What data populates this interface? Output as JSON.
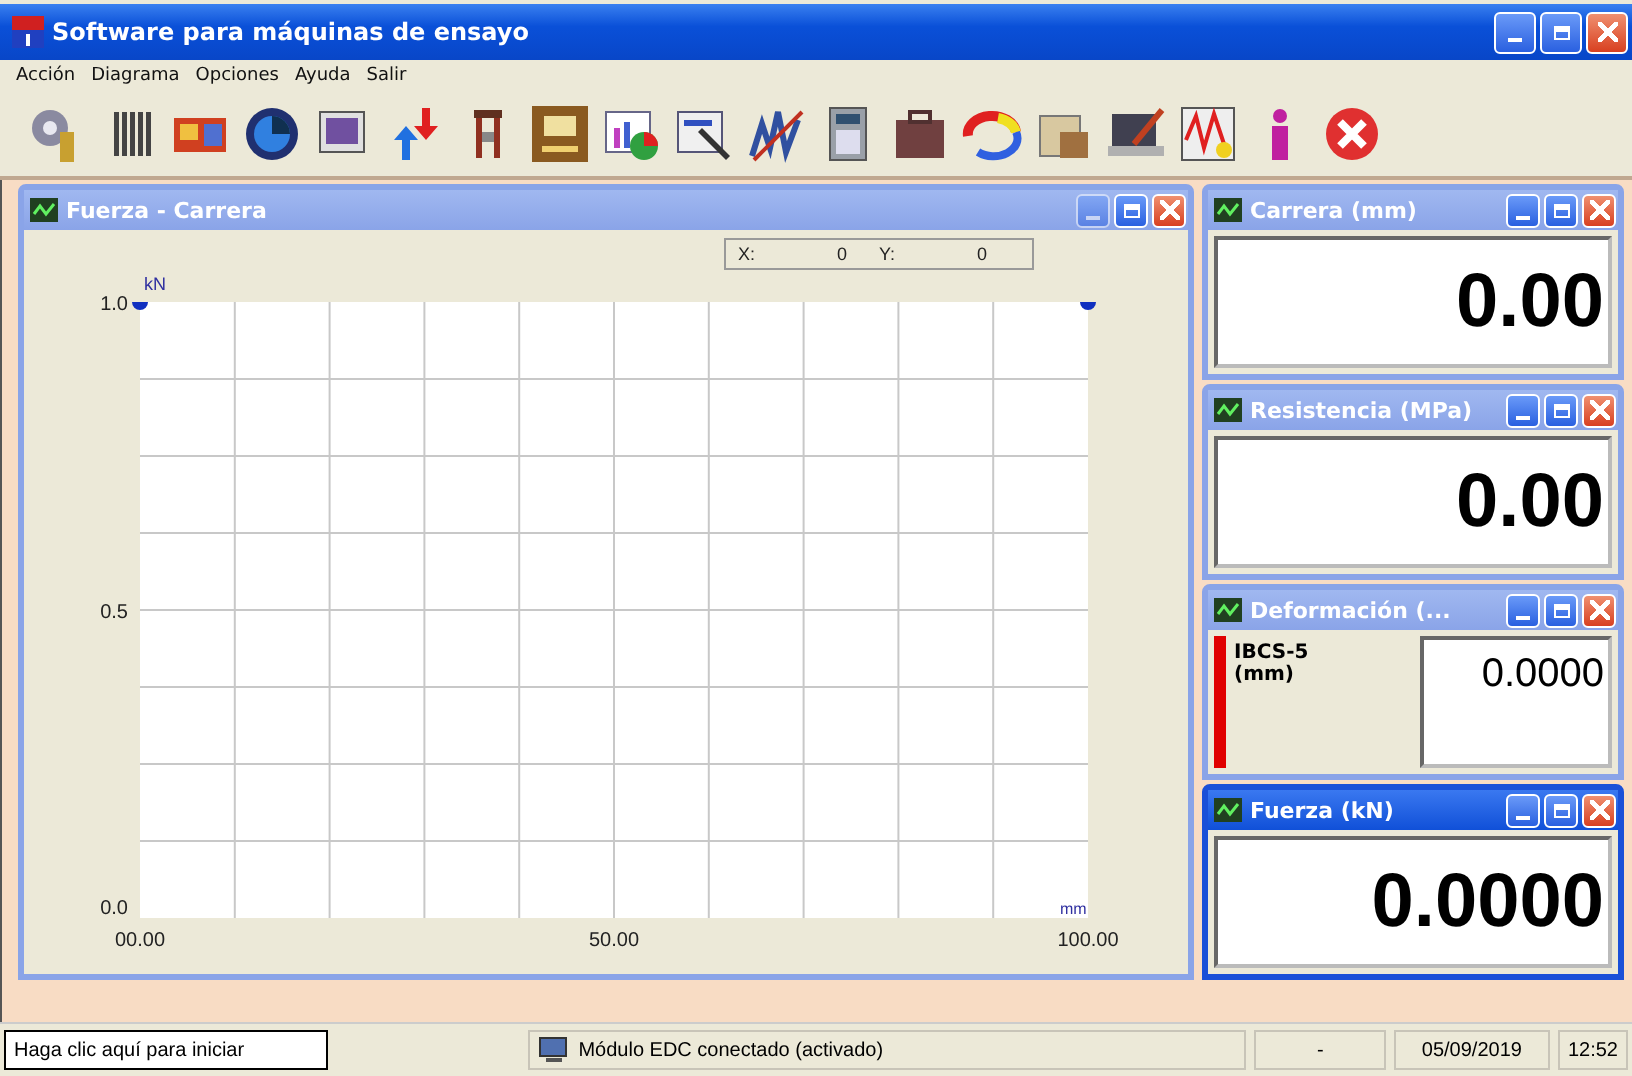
{
  "window": {
    "title": "Software para máquinas de ensayo"
  },
  "menu": [
    {
      "label": "Acción"
    },
    {
      "label": "Diagrama"
    },
    {
      "label": "Opciones"
    },
    {
      "label": "Ayuda"
    },
    {
      "label": "Salir"
    }
  ],
  "chart_window": {
    "title": "Fuerza - Carrera",
    "active": false,
    "cursor": {
      "x_label": "X:",
      "x_value": "0",
      "y_label": "Y:",
      "y_value": "0"
    },
    "chart_data": {
      "type": "line",
      "xlabel": "mm",
      "ylabel": "kN",
      "xlim": [
        0,
        100
      ],
      "ylim": [
        0,
        1
      ],
      "xticks": [
        {
          "value": 0,
          "label": "00.00"
        },
        {
          "value": 50,
          "label": "50.00"
        },
        {
          "value": 100,
          "label": "100.00"
        }
      ],
      "yticks": [
        {
          "value": 0,
          "label": "0.0"
        },
        {
          "value": 0.5,
          "label": "0.5"
        },
        {
          "value": 1,
          "label": "1.0"
        }
      ]
    }
  },
  "monitors": [
    {
      "kind": "display",
      "title": "Carrera (mm)",
      "value": "0.00",
      "active": false
    },
    {
      "kind": "display",
      "title": "Resistencia (MPa)",
      "value": "0.00",
      "active": false
    },
    {
      "kind": "channel",
      "title": "Deformación (...",
      "channel": "IBCS-5",
      "unit": "(mm)",
      "value": "0.0000",
      "active": false
    },
    {
      "kind": "display",
      "title": "Fuerza (kN)",
      "value": "0.0000",
      "active": true
    }
  ],
  "status_bar": {
    "hint": "Haga clic aquí para iniciar",
    "connection": "Módulo EDC conectado (activado)",
    "panel_3": "-",
    "date": "05/09/2019",
    "time": "12:52"
  }
}
